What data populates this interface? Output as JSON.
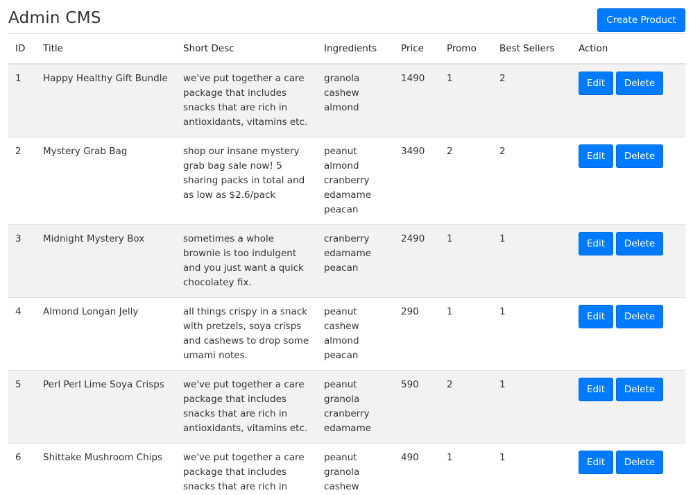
{
  "page": {
    "title": "Admin CMS",
    "create_button_label": "Create Product"
  },
  "table": {
    "headers": [
      "ID",
      "Title",
      "Short Desc",
      "Ingredients",
      "Price",
      "Promo",
      "Best Sellers",
      "Action"
    ],
    "edit_label": "Edit",
    "delete_label": "Delete",
    "rows": [
      {
        "id": "1",
        "title": "Happy Healthy Gift Bundle",
        "short_desc": "we've put together a care package that includes snacks that are rich in antioxidants, vitamins etc.",
        "ingredients": [
          "granola",
          "cashew",
          "almond"
        ],
        "price": "1490",
        "promo": "1",
        "best_sellers": "2"
      },
      {
        "id": "2",
        "title": "Mystery Grab Bag",
        "short_desc": "shop our insane mystery grab bag sale now! 5 sharing packs in total and as low as $2.6/pack",
        "ingredients": [
          "peanut",
          "almond",
          "cranberry",
          "edamame",
          "peacan"
        ],
        "price": "3490",
        "promo": "2",
        "best_sellers": "2"
      },
      {
        "id": "3",
        "title": "Midnight Mystery Box",
        "short_desc": "sometimes a whole brownie is too indulgent and you just want a quick chocolatey fix.",
        "ingredients": [
          "cranberry",
          "edamame",
          "peacan"
        ],
        "price": "2490",
        "promo": "1",
        "best_sellers": "1"
      },
      {
        "id": "4",
        "title": "Almond Longan Jelly",
        "short_desc": "all things crispy in a snack with pretzels, soya crisps and cashews to drop some umami notes.",
        "ingredients": [
          "peanut",
          "cashew",
          "almond",
          "peacan"
        ],
        "price": "290",
        "promo": "1",
        "best_sellers": "1"
      },
      {
        "id": "5",
        "title": "Perl Perl Lime Soya Crisps",
        "short_desc": "we've put together a care package that includes snacks that are rich in antioxidants, vitamins etc.",
        "ingredients": [
          "peanut",
          "granola",
          "cranberry",
          "edamame"
        ],
        "price": "590",
        "promo": "2",
        "best_sellers": "1"
      },
      {
        "id": "6",
        "title": "Shittake Mushroom Chips",
        "short_desc": "we've put together a care package that includes snacks that are rich in antioxidants, vitamins etc.",
        "ingredients": [
          "peanut",
          "granola",
          "cashew"
        ],
        "price": "490",
        "promo": "1",
        "best_sellers": "1"
      }
    ]
  },
  "colors": {
    "primary_button": "#007bff",
    "striped_row": "#f2f2f2",
    "border": "#dee2e6"
  }
}
